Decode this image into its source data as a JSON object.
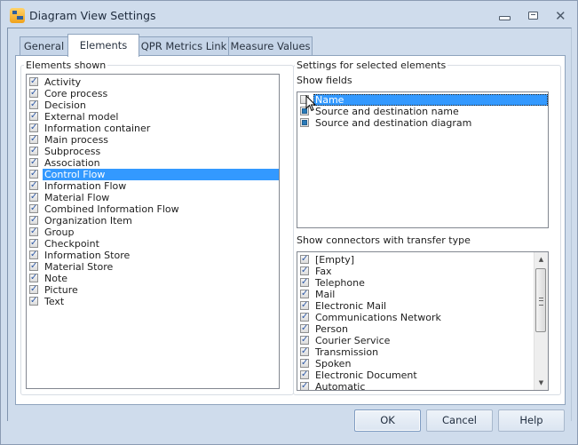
{
  "window": {
    "title": "Diagram View Settings",
    "icon": "diagram-app-icon",
    "controls": [
      "minimize-icon",
      "maximize-icon",
      "close-icon"
    ]
  },
  "tabs": [
    {
      "label": "General",
      "active": false
    },
    {
      "label": "Elements",
      "active": true
    },
    {
      "label": "QPR Metrics Link",
      "active": false
    },
    {
      "label": "Measure Values",
      "active": false
    }
  ],
  "elements_shown": {
    "label": "Elements shown",
    "items": [
      {
        "label": "Activity",
        "checked": true
      },
      {
        "label": "Core process",
        "checked": true
      },
      {
        "label": "Decision",
        "checked": true
      },
      {
        "label": "External model",
        "checked": true
      },
      {
        "label": "Information container",
        "checked": true
      },
      {
        "label": "Main process",
        "checked": true
      },
      {
        "label": "Subprocess",
        "checked": true
      },
      {
        "label": "Association",
        "checked": true
      },
      {
        "label": "Control Flow",
        "checked": true,
        "selected": true
      },
      {
        "label": "Information Flow",
        "checked": true
      },
      {
        "label": "Material Flow",
        "checked": true
      },
      {
        "label": "Combined Information Flow",
        "checked": true
      },
      {
        "label": "Organization Item",
        "checked": true
      },
      {
        "label": "Group",
        "checked": true
      },
      {
        "label": "Checkpoint",
        "checked": true
      },
      {
        "label": "Information Store",
        "checked": true
      },
      {
        "label": "Material Store",
        "checked": true
      },
      {
        "label": "Note",
        "checked": true
      },
      {
        "label": "Picture",
        "checked": true
      },
      {
        "label": "Text",
        "checked": true
      }
    ]
  },
  "settings": {
    "label": "Settings for selected elements",
    "show_fields": {
      "label": "Show fields",
      "items": [
        {
          "label": "Name",
          "state": "unchecked",
          "selected": true
        },
        {
          "label": "Source and destination name",
          "state": "indeterminate"
        },
        {
          "label": "Source and destination diagram",
          "state": "indeterminate"
        }
      ]
    },
    "connectors": {
      "label": "Show connectors with transfer type",
      "items": [
        {
          "label": "[Empty]",
          "checked": true
        },
        {
          "label": "Fax",
          "checked": true
        },
        {
          "label": "Telephone",
          "checked": true
        },
        {
          "label": "Mail",
          "checked": true
        },
        {
          "label": "Electronic Mail",
          "checked": true
        },
        {
          "label": "Communications Network",
          "checked": true
        },
        {
          "label": "Person",
          "checked": true
        },
        {
          "label": "Courier Service",
          "checked": true
        },
        {
          "label": "Transmission",
          "checked": true
        },
        {
          "label": "Spoken",
          "checked": true
        },
        {
          "label": "Electronic Document",
          "checked": true
        },
        {
          "label": "Automatic",
          "checked": true
        }
      ]
    }
  },
  "buttons": {
    "ok": "OK",
    "cancel": "Cancel",
    "help": "Help"
  }
}
